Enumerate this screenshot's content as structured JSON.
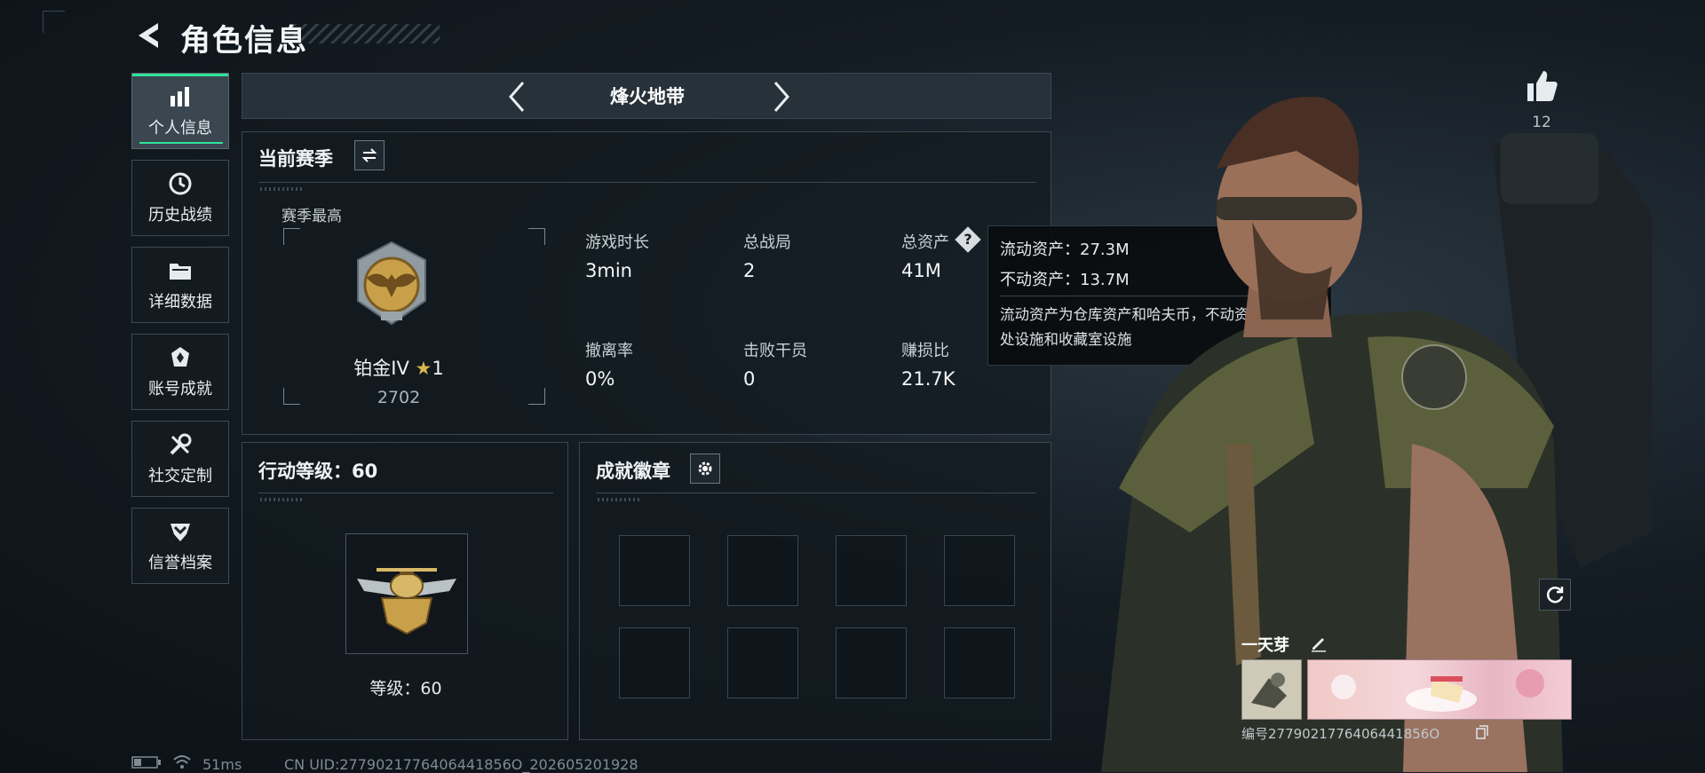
{
  "header": {
    "title": "角色信息"
  },
  "sidebar": {
    "items": [
      {
        "label": "个人信息",
        "icon": "bar-chart-icon",
        "active": true
      },
      {
        "label": "历史战绩",
        "icon": "clock-icon",
        "active": false
      },
      {
        "label": "详细数据",
        "icon": "folder-icon",
        "active": false
      },
      {
        "label": "账号成就",
        "icon": "achievement-icon",
        "active": false
      },
      {
        "label": "社交定制",
        "icon": "wrench-icon",
        "active": false
      },
      {
        "label": "信誉档案",
        "icon": "shield-rank-icon",
        "active": false
      }
    ]
  },
  "mode": {
    "label": "烽火地带"
  },
  "season": {
    "title": "当前赛季",
    "best_label": "赛季最高",
    "rank_name": "铂金IV",
    "rank_stars": "1",
    "rank_points": "2702",
    "stats": [
      {
        "label": "游戏时长",
        "value": "3min"
      },
      {
        "label": "总战局",
        "value": "2"
      },
      {
        "label": "总资产",
        "value": "41M"
      },
      {
        "label": "撤离率",
        "value": "0%"
      },
      {
        "label": "击败干员",
        "value": "0"
      },
      {
        "label": "赚损比",
        "value": "21.7K"
      }
    ]
  },
  "tooltip": {
    "liquid": "流动资产：27.3M",
    "fixed": "不动资产：13.7M",
    "desc": "流动资产为仓库资产和哈夫币，不动资产为特勤处设施和收藏室设施"
  },
  "action_level": {
    "title": "行动等级：60",
    "level_label": "等级：60"
  },
  "achievements": {
    "title": "成就徽章"
  },
  "likes": {
    "count": "12"
  },
  "player": {
    "name": "一天芽",
    "uid_label": "编号2779021776406441856O"
  },
  "status_bar": {
    "ping": "51ms",
    "uid": "CN UID:2779021776406441856O_202605201928"
  },
  "colors": {
    "accent": "#2fe39a",
    "panel_bg": "#12191f",
    "gold": "#c9a04a"
  }
}
